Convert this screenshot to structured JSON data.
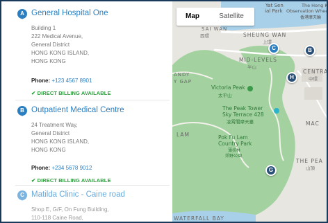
{
  "clinics": [
    {
      "letter": "A",
      "name": "General Hospital One",
      "address": [
        "Building 1",
        "222 Medical Avenue,",
        "General District",
        "HONG KONG ISLAND,",
        "HONG KONG"
      ],
      "phone_label": "Phone:",
      "phone": "+123 4567 8901",
      "billing": "✔ DIRECT BILLING AVAILABLE"
    },
    {
      "letter": "B",
      "name": "Outpatient Medical Centre",
      "address": [
        "24 Treatment Way,",
        "General District",
        "HONG KONG ISLAND,",
        "HONG KONG"
      ],
      "phone_label": "Phone:",
      "phone": "+234 5678 9012",
      "billing": "✔ DIRECT BILLING AVAILABLE"
    },
    {
      "letter": "C",
      "name": "Matilda Clinic - Caine road",
      "address": [
        "Shop E, G/F, On Fung Building,",
        "110-118 Caine Road,"
      ]
    }
  ],
  "map": {
    "tabs": {
      "map": "Map",
      "satellite": "Satellite"
    },
    "labels": {
      "yat_sen": "Yat Sen",
      "ial_park": "ial Park",
      "hong_kong": "The Hong K",
      "observation": "Observation Wheel",
      "observation_cn": "香港摩天輪",
      "sai_wan": "SAI WAN",
      "sai_wan_cn": "西環",
      "sheung_wan": "SHEUNG WAN",
      "sheung_wan_cn": "上環",
      "mid_levels": "MID-LEVELS",
      "mid_levels_cn": "半山",
      "centra": "CENTRA",
      "centra_cn": "中環",
      "andy": "ANDY",
      "y_gap": "Y GAP",
      "victoria_peak": "Victoria Peak",
      "victoria_peak_cn": "太平山",
      "peak_tower_1": "The Peak Tower",
      "peak_tower_2": "Sky Terrace 428",
      "peak_tower_cn": "凌霄閣摩天臺",
      "lam": "LAM",
      "pok_fu_lam_1": "Pok Fu Lam",
      "pok_fu_lam_2": "Country Park",
      "pok_fu_lam_cn_1": "薄扶林",
      "pok_fu_lam_cn_2": "郊野公園",
      "mac": "MAC",
      "the_pea": "THE PEA",
      "the_pea_cn": "山頂",
      "waterfall_bay": "WATERFALL BAY"
    },
    "pins": [
      "C",
      "B",
      "H",
      "G"
    ],
    "colors": {
      "water": "#a8d0e8",
      "park": "#a3d2a0",
      "land": "#e8e6e1",
      "pin": "#2b7fc1",
      "billing": "#2e9e3e"
    }
  }
}
